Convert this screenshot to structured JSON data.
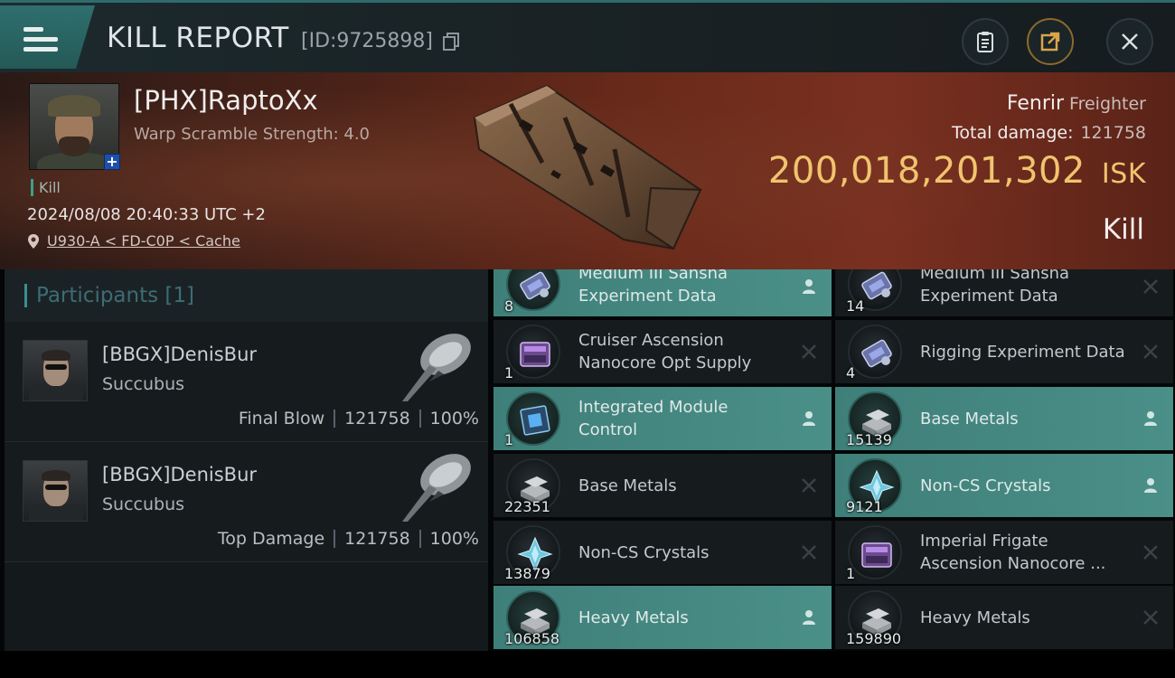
{
  "header": {
    "title": "KILL REPORT",
    "report_id": "[ID:9725898]"
  },
  "victim": {
    "name": "[PHX]RaptoXx",
    "warp_scramble": "Warp Scramble Strength: 4.0",
    "kill_tag": "Kill",
    "datetime": "2024/08/08 20:40:33 UTC +2",
    "location": "U930-A < FD-C0P < Cache",
    "ship_name": "Fenrir",
    "ship_class": "Freighter",
    "total_damage_label": "Total damage:",
    "total_damage": "121758",
    "isk_value": "200,018,201,302",
    "isk_unit": "ISK",
    "result": "Kill"
  },
  "participants": {
    "label": "Participants",
    "count": "[1]",
    "rows": [
      {
        "name": "[BBGX]DenisBur",
        "ship": "Succubus",
        "role": "Final Blow",
        "damage": "121758",
        "percent": "100%"
      },
      {
        "name": "[BBGX]DenisBur",
        "ship": "Succubus",
        "role": "Top Damage",
        "damage": "121758",
        "percent": "100%"
      }
    ]
  },
  "items": [
    {
      "name": "Medium III Sansha Experiment Data",
      "qty": "8",
      "status": "dropped",
      "icon": "experiment-data-icon"
    },
    {
      "name": "Medium III Sansha Experiment Data",
      "qty": "14",
      "status": "destroyed",
      "icon": "experiment-data-icon"
    },
    {
      "name": "Cruiser Ascension Nanocore Opt Supply",
      "qty": "1",
      "status": "destroyed",
      "icon": "nanocore-crate-icon"
    },
    {
      "name": "Rigging Experiment Data",
      "qty": "4",
      "status": "destroyed",
      "icon": "experiment-data-icon"
    },
    {
      "name": "Integrated Module Control",
      "qty": "1",
      "status": "dropped",
      "icon": "module-chip-icon"
    },
    {
      "name": "Base Metals",
      "qty": "15139",
      "status": "dropped",
      "icon": "metal-ingot-icon"
    },
    {
      "name": "Base Metals",
      "qty": "22351",
      "status": "destroyed",
      "icon": "metal-ingot-icon"
    },
    {
      "name": "Non-CS Crystals",
      "qty": "9121",
      "status": "dropped",
      "icon": "crystal-icon"
    },
    {
      "name": "Non-CS Crystals",
      "qty": "13879",
      "status": "destroyed",
      "icon": "crystal-icon"
    },
    {
      "name": "Imperial Frigate Ascension Nanocore ...",
      "qty": "1",
      "status": "destroyed",
      "icon": "nanocore-crate-icon"
    },
    {
      "name": "Heavy Metals",
      "qty": "106858",
      "status": "dropped",
      "icon": "metal-ingot-icon"
    },
    {
      "name": "Heavy Metals",
      "qty": "159890",
      "status": "destroyed",
      "icon": "metal-ingot-icon"
    }
  ],
  "colors": {
    "accent_teal": "#3f7f79",
    "isk_gold": "#f0c46e",
    "banner_red": "#6a2a1a"
  }
}
